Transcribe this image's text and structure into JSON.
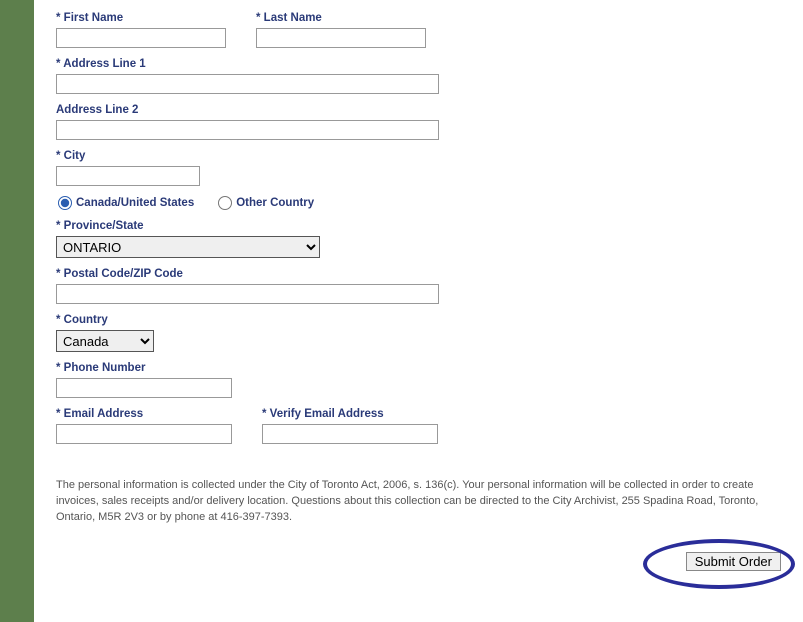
{
  "labels": {
    "first_name": "* First Name",
    "last_name": "* Last Name",
    "address1": "* Address Line 1",
    "address2": "Address Line 2",
    "city": "* City",
    "province": "* Province/State",
    "postal": "* Postal Code/ZIP Code",
    "country": "* Country",
    "phone": "* Phone Number",
    "email": "* Email Address",
    "verify_email": "* Verify Email Address"
  },
  "radio": {
    "canada_us": "Canada/United States",
    "other_country": "Other Country"
  },
  "values": {
    "first_name": "",
    "last_name": "",
    "address1": "",
    "address2": "",
    "city": "",
    "province_selected": "ONTARIO",
    "postal": "",
    "country_selected": "Canada",
    "phone": "",
    "email": "",
    "verify_email": ""
  },
  "disclaimer": "The personal information is collected under the City of Toronto Act, 2006, s. 136(c). Your personal information will be collected in order to create invoices, sales receipts and/or delivery location. Questions about this collection can be directed to the City Archivist, 255 Spadina Road, Toronto, Ontario, M5R 2V3 or by phone at 416-397-7393.",
  "buttons": {
    "submit": "Submit Order"
  }
}
